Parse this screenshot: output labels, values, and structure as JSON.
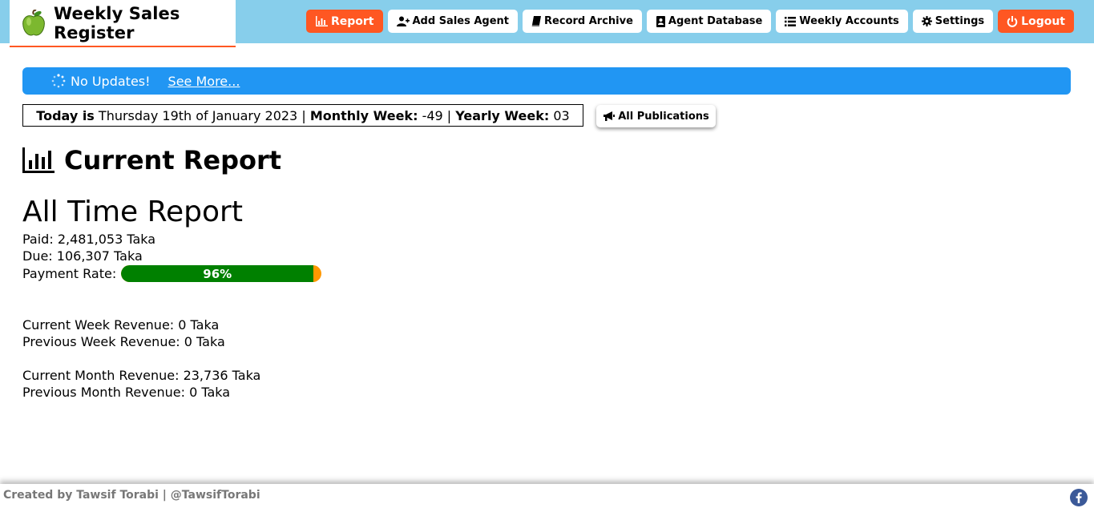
{
  "header": {
    "app_title": "Weekly Sales Register",
    "brand_icon": "apple-icon",
    "nav": [
      {
        "label": "Report",
        "icon": "bar-chart-icon",
        "active": true
      },
      {
        "label": "Add Sales Agent",
        "icon": "add-user-icon"
      },
      {
        "label": "Record Archive",
        "icon": "book-icon"
      },
      {
        "label": "Agent Database",
        "icon": "address-book-icon"
      },
      {
        "label": "Weekly Accounts",
        "icon": "list-icon"
      },
      {
        "label": "Settings",
        "icon": "gear-icon"
      },
      {
        "label": "Logout",
        "icon": "power-icon",
        "active": true
      }
    ]
  },
  "banner": {
    "text": "No Updates!",
    "link": "See More...",
    "icon": "spinner-icon"
  },
  "date_info": {
    "today_label": "Today is",
    "today_value": "Thursday 19th of January 2023",
    "monthly_week_label": "Monthly Week:",
    "monthly_week_value": "-49",
    "yearly_week_label": "Yearly Week:",
    "yearly_week_value": "03",
    "separator": "|"
  },
  "publications_button": {
    "label": "All Publications",
    "icon": "megaphone-icon"
  },
  "report": {
    "heading": "Current Report",
    "heading_icon": "bar-chart-icon",
    "all_time_title": "All Time Report",
    "paid": "Paid: 2,481,053 Taka",
    "due": "Due: 106,307 Taka",
    "payment_rate_label": "Payment Rate:",
    "payment_rate_text": "96%",
    "payment_rate_value": 0.96,
    "current_week": "Current Week Revenue: 0 Taka",
    "previous_week": "Previous Week Revenue: 0 Taka",
    "current_month": "Current Month Revenue: 23,736 Taka",
    "previous_month": "Previous Month Revenue: 0 Taka"
  },
  "footer": {
    "credit": "Created by Tawsif Torabi | @TawsifTorabi",
    "social_icon": "facebook-icon"
  },
  "colors": {
    "header_bg": "#87ceeb",
    "accent": "#ff5722",
    "banner": "#2196f3",
    "progress_paid": "#008000",
    "progress_due": "#ff9800"
  }
}
